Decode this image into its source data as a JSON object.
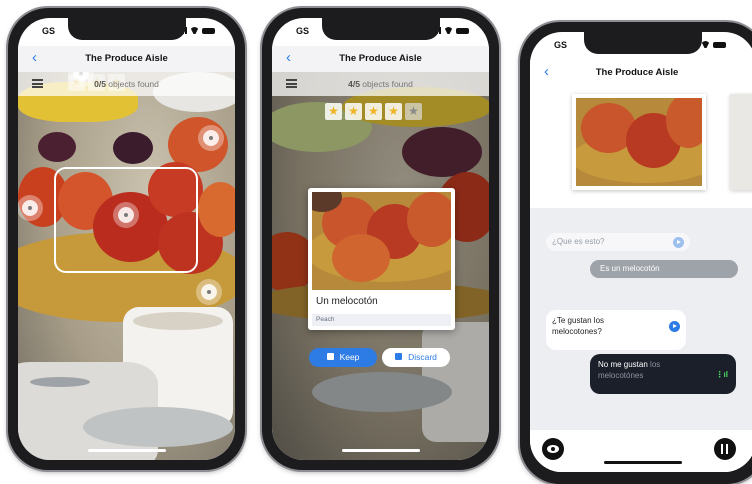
{
  "status": {
    "carrier": "GS"
  },
  "screen_title": "The Produce Aisle",
  "phone1": {
    "counter_num": "0/5",
    "counter_rest": " objects found"
  },
  "phone2": {
    "counter_num": "4/5",
    "counter_rest": " objects found",
    "card_word": "Un melocotón",
    "card_translation": "Peach",
    "keep_label": "Keep",
    "discard_label": "Discard"
  },
  "phone3": {
    "msg1": "¿Que es esto?",
    "msg2": "Es un melocotón",
    "msg3": "¿Te gustan los melocotones?",
    "msg4_a": "No me gustan",
    "msg4_b": " los melocotónes"
  },
  "colors": {
    "accent": "#2b7de9",
    "star": "#f0b324",
    "keep_button": "#2d7be5",
    "dark_bubble": "#1b1f2a"
  },
  "icons": [
    "back-chevron-icon",
    "list-icon",
    "star-icon",
    "thumbs-up-icon",
    "thumbs-down-icon",
    "speaker-icon",
    "waveform-icon",
    "eye-icon",
    "pause-icon"
  ]
}
